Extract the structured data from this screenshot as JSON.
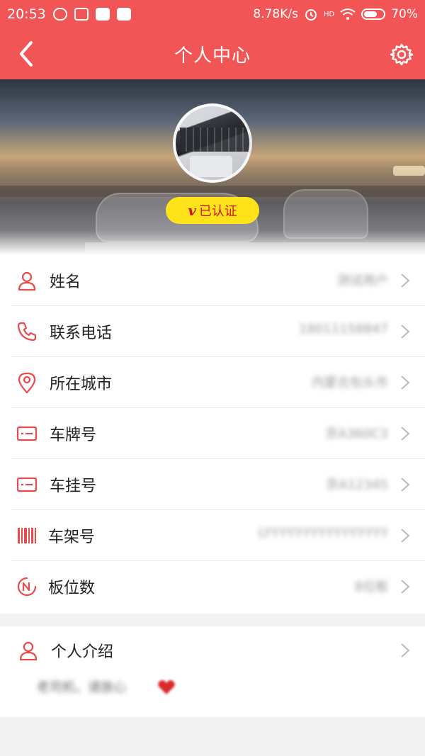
{
  "status_bar": {
    "time": "20:53",
    "net_speed": "8.78K/s",
    "signal_tag": "HD",
    "battery": "70%"
  },
  "nav": {
    "title": "个人中心",
    "back_icon": "chevron-left-icon",
    "settings_icon": "gear-icon"
  },
  "profile": {
    "verified_badge": "已认证",
    "badge_v": "v"
  },
  "fields": [
    {
      "label": "姓名",
      "value": "测试用户",
      "icon": "person-icon"
    },
    {
      "label": "联系电话",
      "value": "18011158847",
      "icon": "phone-icon"
    },
    {
      "label": "所在城市",
      "value": "内蒙古包头市",
      "icon": "location-pin-icon"
    },
    {
      "label": "车牌号",
      "value": "京A360C3",
      "icon": "plate-card-icon"
    },
    {
      "label": "车挂号",
      "value": "京A12345",
      "icon": "trailer-card-icon"
    },
    {
      "label": "车架号",
      "value": "LYYYYYYYYYYYYYYYY",
      "icon": "barcode-icon"
    },
    {
      "label": "板位数",
      "value": "8位板",
      "icon": "board-count-icon"
    }
  ],
  "intro": {
    "label": "个人介绍",
    "text": "老司机，请放心"
  },
  "colors": {
    "primary": "#f25555",
    "badge_bg": "#ffe31a",
    "badge_text": "#d0141c",
    "icon_red": "#e84b4b"
  }
}
